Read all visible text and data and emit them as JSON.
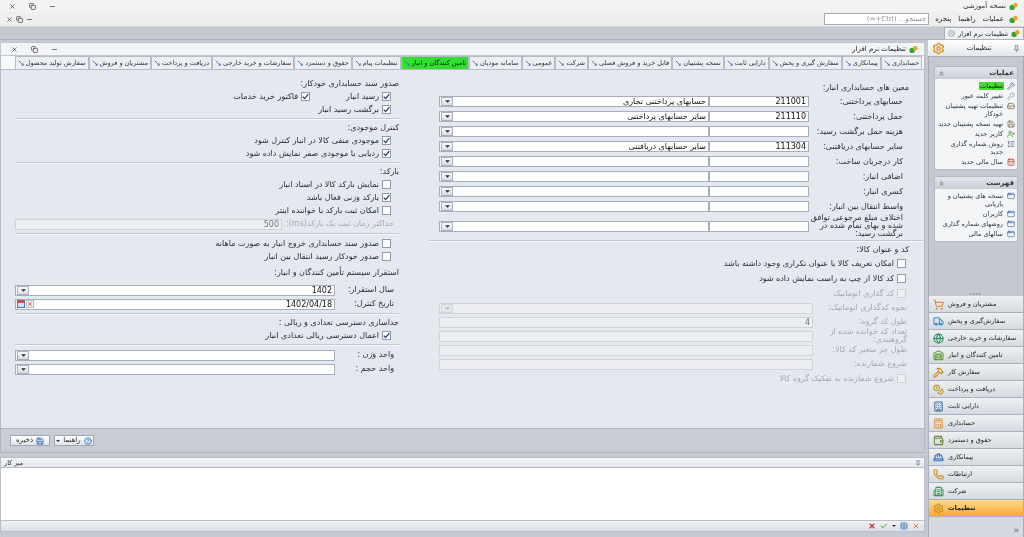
{
  "app": {
    "title": "نسخه آموزشی"
  },
  "menu": {
    "items": [
      "عملیات",
      "راهنما",
      "پنجره"
    ],
    "search": {
      "placeholder": "جستجو... (Ctrl+=)"
    }
  },
  "document_tabs": [
    {
      "label": "تنظیمات نرم افزار",
      "selected": true
    }
  ],
  "panel": {
    "title": "تنظیمات نرم افزار"
  },
  "tabs": [
    {
      "label": "حسابداری",
      "selected": false
    },
    {
      "label": "پیمانکاری",
      "selected": false
    },
    {
      "label": "سفارش گیری و پخش",
      "selected": false
    },
    {
      "label": "دارایی ثابت",
      "selected": false
    },
    {
      "label": "نسخه پشتیبان",
      "selected": false
    },
    {
      "label": "قابل خرید و فروش فصلی",
      "selected": false
    },
    {
      "label": "شرکت",
      "selected": false
    },
    {
      "label": "عمومی",
      "selected": false
    },
    {
      "label": "سامانه مودیان",
      "selected": false
    },
    {
      "label": "تامین کنندگان و انبار",
      "selected": true
    },
    {
      "label": "تنظیمات پیام",
      "selected": false
    },
    {
      "label": "حقوق و دستمزد",
      "selected": false
    },
    {
      "label": "سفارشات و خرید خارجی",
      "selected": false
    },
    {
      "label": "دریافت و پرداخت",
      "selected": false
    },
    {
      "label": "مشتریان و فروش",
      "selected": false
    },
    {
      "label": "سفارش تولید محصول",
      "selected": false
    }
  ],
  "form": {
    "right_column": [
      {
        "items": [
          {
            "kind": "heading",
            "text": "معین های حسابداری انبار:"
          },
          {
            "kind": "account",
            "label": "حسابهای پرداختنی:",
            "code": "211001",
            "account": "حسابهای پرداختنی تجاری",
            "disabled": false
          },
          {
            "kind": "account",
            "label": "حمل پرداختنی:",
            "code": "211110",
            "account": "سایر حسابهای پرداختنی",
            "disabled": false
          },
          {
            "kind": "account",
            "label": "هزینه حمل برگشت رسید:",
            "disabled": false
          },
          {
            "kind": "account",
            "label": "سایر حسابهای دریافتنی:",
            "code": "111304",
            "account": "سایر حسابهای دریافتنی",
            "disabled": false
          },
          {
            "kind": "account",
            "label": "کار درجریان ساخت:",
            "disabled": false
          },
          {
            "kind": "account",
            "label": "اضافی انبار:",
            "disabled": false
          },
          {
            "kind": "account",
            "label": "کسری انبار:",
            "disabled": false
          },
          {
            "kind": "account",
            "label": "واسط انتقال بین انبار:",
            "disabled": false
          },
          {
            "kind": "account",
            "label": "اختلاف مبلغ مرجوعی توافق شده و بهای تمام شده در برگشت رسید:",
            "disabled": false
          }
        ]
      },
      {
        "items": [
          {
            "kind": "heading",
            "text": "کد و عنوان کالا:"
          },
          {
            "kind": "checkbox",
            "label": "امکان تعریف کالا با عنوان تکراری وجود داشته باشد",
            "checked": false,
            "disabled": false
          },
          {
            "kind": "checkbox",
            "label": "کد کالا از چپ به راست نمایش داده شود",
            "checked": false,
            "disabled": false
          },
          {
            "kind": "checkbox",
            "label": "کد گذاری اتوماتیک",
            "checked": false,
            "disabled": true
          },
          {
            "kind": "combo",
            "label": "نحوه کدگذاری اتوماتیک:",
            "disabled": true
          },
          {
            "kind": "field",
            "label": "طول کد گروه:",
            "value": "4",
            "disabled": true
          },
          {
            "kind": "field",
            "label": "تعداد کد خوانده شده از گروهبندی:",
            "disabled": true
          },
          {
            "kind": "field",
            "label": "طول جز متغیر کد کالا:",
            "disabled": true
          },
          {
            "kind": "field",
            "label": "شروع شمارنده:",
            "disabled": true
          },
          {
            "kind": "checkbox",
            "label": "شروع شمارنده به تفکیک گروه کالا",
            "checked": false,
            "disabled": true
          }
        ]
      }
    ],
    "left_column": [
      {
        "items": [
          {
            "kind": "heading",
            "text": "صدور سند حسابداری خودکار:"
          },
          {
            "kind": "checkbox_pair",
            "checkboxes": [
              {
                "label": "رسید انبار",
                "checked": true,
                "disabled": false
              },
              {
                "label": "فاکتور خرید خدمات",
                "checked": true,
                "disabled": false
              }
            ]
          },
          {
            "kind": "checkbox",
            "label": "برگشت رسید انبار",
            "checked": true,
            "disabled": false
          }
        ]
      },
      {
        "items": [
          {
            "kind": "heading",
            "text": "کنترل موجودی:"
          },
          {
            "kind": "checkbox",
            "label": "موجودی منفی کالا در انبار کنترل شود",
            "checked": true,
            "disabled": false
          },
          {
            "kind": "checkbox",
            "label": "ردیابی با موجودی صفر نمایش داده شود",
            "checked": true,
            "disabled": false
          }
        ]
      },
      {
        "items": [
          {
            "kind": "heading",
            "text": "بارکد:"
          },
          {
            "kind": "checkbox",
            "label": "نمایش بارکد کالا در اسناد انبار",
            "checked": false,
            "disabled": false
          },
          {
            "kind": "checkbox",
            "label": "بارکد وزنی فعال باشد",
            "checked": true,
            "disabled": false
          },
          {
            "kind": "checkbox",
            "label": "امکان ثبت بارکد با خواننده اینتر",
            "checked": false,
            "disabled": false
          },
          {
            "kind": "field",
            "label": "حداکثر زمان ثبت یک بارکد(ms):",
            "value": "500",
            "disabled": true
          }
        ]
      },
      {
        "items": [
          {
            "kind": "checkbox",
            "label": "صدور سند حسابداری خروج انبار به صورت ماهانه",
            "checked": false,
            "disabled": false
          },
          {
            "kind": "checkbox",
            "label": "صدور خودکار رسید انتقال بین انبار",
            "checked": false,
            "disabled": false
          },
          {
            "kind": "heading",
            "text": "استقرار سیستم تأمین کنندگان و انبار:"
          },
          {
            "kind": "combo",
            "label": "سال استقرار:",
            "value": "1402",
            "disabled": false
          },
          {
            "kind": "date",
            "label": "تاریخ کنترل:",
            "value": "1402/04/18",
            "disabled": false
          }
        ]
      },
      {
        "items": [
          {
            "kind": "heading",
            "text": "جداسازی دسترسی تعدادی و ریالی :"
          },
          {
            "kind": "checkbox",
            "label": "اعمال دسترسی ریالی تعدادی انبار",
            "checked": true,
            "disabled": false
          }
        ]
      },
      {
        "items": [
          {
            "kind": "combo",
            "label": "واحد وزن :",
            "disabled": false
          },
          {
            "kind": "combo",
            "label": "واحد حجم :",
            "disabled": false
          }
        ]
      }
    ]
  },
  "actions": [
    {
      "kind": "help",
      "label": "راهنما"
    },
    {
      "kind": "save",
      "label": "ذخیره"
    }
  ],
  "workspace": {
    "title": "میز کار"
  },
  "sidebar": {
    "title": "تنظیمات",
    "groups": [
      {
        "title": "عملیات",
        "items": [
          {
            "label": "تنظیمات",
            "selected": true
          },
          {
            "label": "تغییر کلمه عبور",
            "selected": false
          },
          {
            "label": "تنظیمات تهیه پشتیبان خودکار",
            "selected": false
          },
          {
            "label": "تهیه نسخه پشتیبان جدید",
            "selected": false
          },
          {
            "label": "کاربر جدید",
            "selected": false
          },
          {
            "label": "روش شماره گذاری جدید",
            "selected": false
          },
          {
            "label": "سال مالی جدید",
            "selected": false
          }
        ]
      },
      {
        "title": "فهرست",
        "items": [
          {
            "label": "نسخه های پشتیبان و بازیابی",
            "selected": false
          },
          {
            "label": "کاربران",
            "selected": false
          },
          {
            "label": "روشهای شماره گذاری",
            "selected": false
          },
          {
            "label": "سالهای مالی",
            "selected": false
          }
        ]
      }
    ],
    "modules": [
      {
        "label": "مشتریان و فروش",
        "selected": false
      },
      {
        "label": "سفارش‌گیری و پخش",
        "selected": false
      },
      {
        "label": "سفارشات و خرید خارجی",
        "selected": false
      },
      {
        "label": "تامین کنندگان و انبار",
        "selected": false
      },
      {
        "label": "سفارش کار",
        "selected": false
      },
      {
        "label": "دریافت و پرداخت",
        "selected": false
      },
      {
        "label": "دارایی ثابت",
        "selected": false
      },
      {
        "label": "حسابداری",
        "selected": false
      },
      {
        "label": "حقوق و دستمزد",
        "selected": false
      },
      {
        "label": "پیمانکاری",
        "selected": false
      },
      {
        "label": "ارتباطات",
        "selected": false
      },
      {
        "label": "شرکت",
        "selected": false
      },
      {
        "label": "تنظیمات",
        "selected": true
      }
    ]
  }
}
